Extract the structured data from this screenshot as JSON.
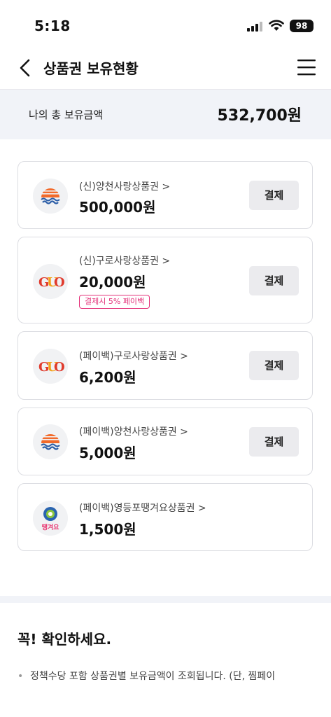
{
  "status_bar": {
    "time": "5:18",
    "battery": "98"
  },
  "header": {
    "title": "상품권 보유현황"
  },
  "summary": {
    "label": "나의 총 보유금액",
    "total": "532,700원"
  },
  "vouchers": [
    {
      "name": "(신)양천사랑상품권 >",
      "amount": "500,000원",
      "button": "결제",
      "logo": "sunrise-wave-logo"
    },
    {
      "name": "(신)구로사랑상품권 >",
      "amount": "20,000원",
      "button": "결제",
      "badge": "결제시 5% 페이백",
      "logo": "guro-logo"
    },
    {
      "name": "(페이백)구로사랑상품권 >",
      "amount": "6,200원",
      "button": "결제",
      "logo": "guro-logo"
    },
    {
      "name": "(페이백)양천사랑상품권 >",
      "amount": "5,000원",
      "button": "결제",
      "logo": "sunrise-wave-logo"
    },
    {
      "name": "(페이백)영등포땡겨요상품권 >",
      "amount": "1,500원",
      "logo": "yeongdeungpo-logo"
    }
  ],
  "notice": {
    "title": "꼭! 확인하세요.",
    "items": [
      "정책수당 포함 상품권별 보유금액이 조회됩니다. (단, 찜페이"
    ]
  },
  "colors": {
    "accent": "#e4327a",
    "band": "#f1f3f8",
    "button": "#ebebee"
  }
}
